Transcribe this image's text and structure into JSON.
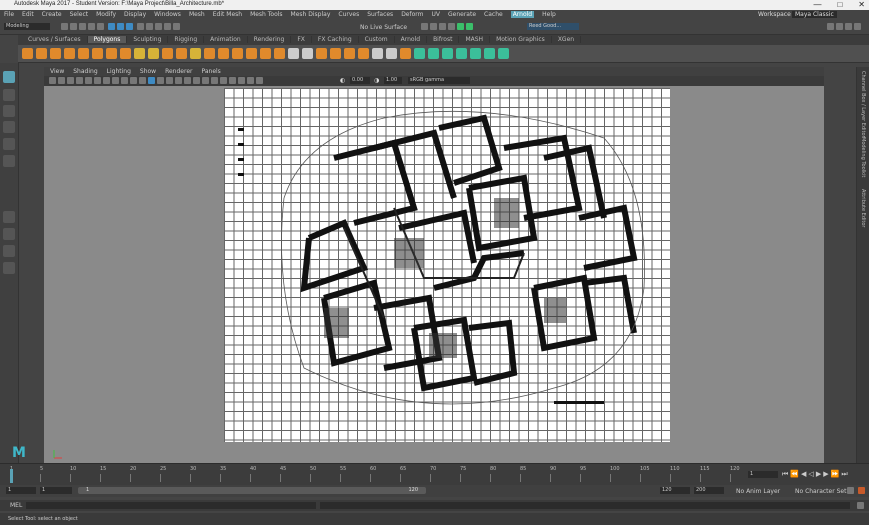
{
  "window": {
    "title": "Autodesk Maya 2017 - Student Version: F:\\Maya Project\\Billa_Architecture.mb*",
    "controls": [
      "—",
      "□",
      "✕"
    ]
  },
  "menubar": {
    "items": [
      "File",
      "Edit",
      "Create",
      "Select",
      "Modify",
      "Display",
      "Windows",
      "Mesh",
      "Edit Mesh",
      "Mesh Tools",
      "Mesh Display",
      "Curves",
      "Surfaces",
      "Deform",
      "UV",
      "Generate",
      "Cache",
      "Arnold",
      "Help"
    ],
    "highlighted": "Arnold",
    "workspace_label": "Workspace :",
    "workspace_value": "Maya Classic"
  },
  "statusline": {
    "mode": "Modeling",
    "live_surface": "No Live Surface",
    "user": "Reed Good..."
  },
  "shelf": {
    "tabs": [
      "Curves / Surfaces",
      "Polygons",
      "Sculpting",
      "Rigging",
      "Animation",
      "Rendering",
      "FX",
      "FX Caching",
      "Custom",
      "Arnold",
      "Bifrost",
      "MASH",
      "Motion Graphics",
      "XGen"
    ],
    "active_tab": "Polygons"
  },
  "panel": {
    "menus": [
      "View",
      "Shading",
      "Lighting",
      "Show",
      "Renderer",
      "Panels"
    ],
    "exposure": "0.00",
    "gamma": "1.00",
    "color_space": "sRGB gamma"
  },
  "right_strip": {
    "labels": [
      "Channel Box / Layer Editor",
      "Modeling Toolkit",
      "Attribute Editor"
    ]
  },
  "timeline": {
    "ticks": [
      "1",
      "5",
      "10",
      "15",
      "20",
      "25",
      "30",
      "35",
      "40",
      "45",
      "50",
      "55",
      "60",
      "65",
      "70",
      "75",
      "80",
      "85",
      "90",
      "95",
      "100",
      "105",
      "110",
      "115",
      "120"
    ],
    "current_frame": "1"
  },
  "range": {
    "start": "1",
    "inner_start": "1",
    "range_start_label": "1",
    "range_end_label": "120",
    "end": "120",
    "outer_end": "200",
    "anim_layer": "No Anim Layer",
    "character_set": "No Character Set"
  },
  "commandline": {
    "label": "MEL"
  },
  "helpline": {
    "text": "Select Tool: select an object"
  },
  "colors": {
    "accent": "#5aa2b5",
    "viewport_bg": "#8a8a8a",
    "ui_bg": "#444444"
  }
}
